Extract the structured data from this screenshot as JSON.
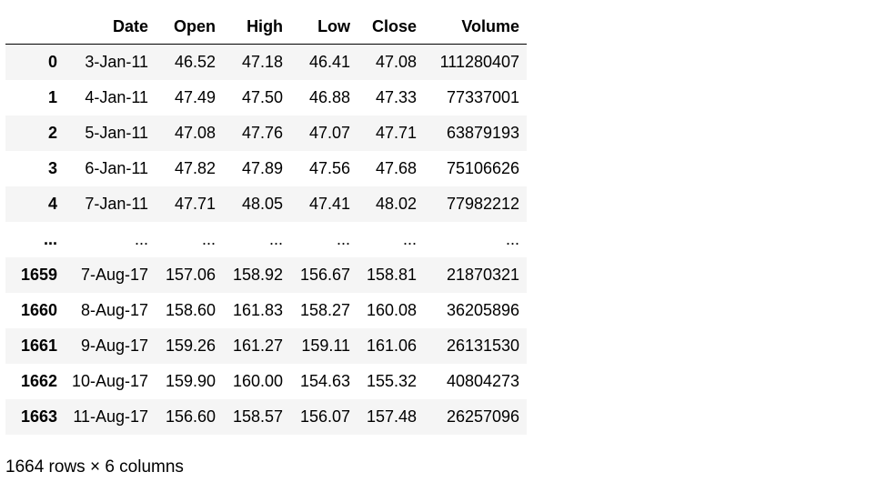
{
  "table": {
    "index_header": "",
    "columns": [
      "Date",
      "Open",
      "High",
      "Low",
      "Close",
      "Volume"
    ],
    "rows": [
      {
        "index": "0",
        "cells": [
          "3-Jan-11",
          "46.52",
          "47.18",
          "46.41",
          "47.08",
          "111280407"
        ]
      },
      {
        "index": "1",
        "cells": [
          "4-Jan-11",
          "47.49",
          "47.50",
          "46.88",
          "47.33",
          "77337001"
        ]
      },
      {
        "index": "2",
        "cells": [
          "5-Jan-11",
          "47.08",
          "47.76",
          "47.07",
          "47.71",
          "63879193"
        ]
      },
      {
        "index": "3",
        "cells": [
          "6-Jan-11",
          "47.82",
          "47.89",
          "47.56",
          "47.68",
          "75106626"
        ]
      },
      {
        "index": "4",
        "cells": [
          "7-Jan-11",
          "47.71",
          "48.05",
          "47.41",
          "48.02",
          "77982212"
        ]
      },
      {
        "index": "...",
        "cells": [
          "...",
          "...",
          "...",
          "...",
          "...",
          "..."
        ]
      },
      {
        "index": "1659",
        "cells": [
          "7-Aug-17",
          "157.06",
          "158.92",
          "156.67",
          "158.81",
          "21870321"
        ]
      },
      {
        "index": "1660",
        "cells": [
          "8-Aug-17",
          "158.60",
          "161.83",
          "158.27",
          "160.08",
          "36205896"
        ]
      },
      {
        "index": "1661",
        "cells": [
          "9-Aug-17",
          "159.26",
          "161.27",
          "159.11",
          "161.06",
          "26131530"
        ]
      },
      {
        "index": "1662",
        "cells": [
          "10-Aug-17",
          "159.90",
          "160.00",
          "154.63",
          "155.32",
          "40804273"
        ]
      },
      {
        "index": "1663",
        "cells": [
          "11-Aug-17",
          "156.60",
          "158.57",
          "156.07",
          "157.48",
          "26257096"
        ]
      }
    ]
  },
  "footer": {
    "shape_text": "1664 rows × 6 columns"
  }
}
